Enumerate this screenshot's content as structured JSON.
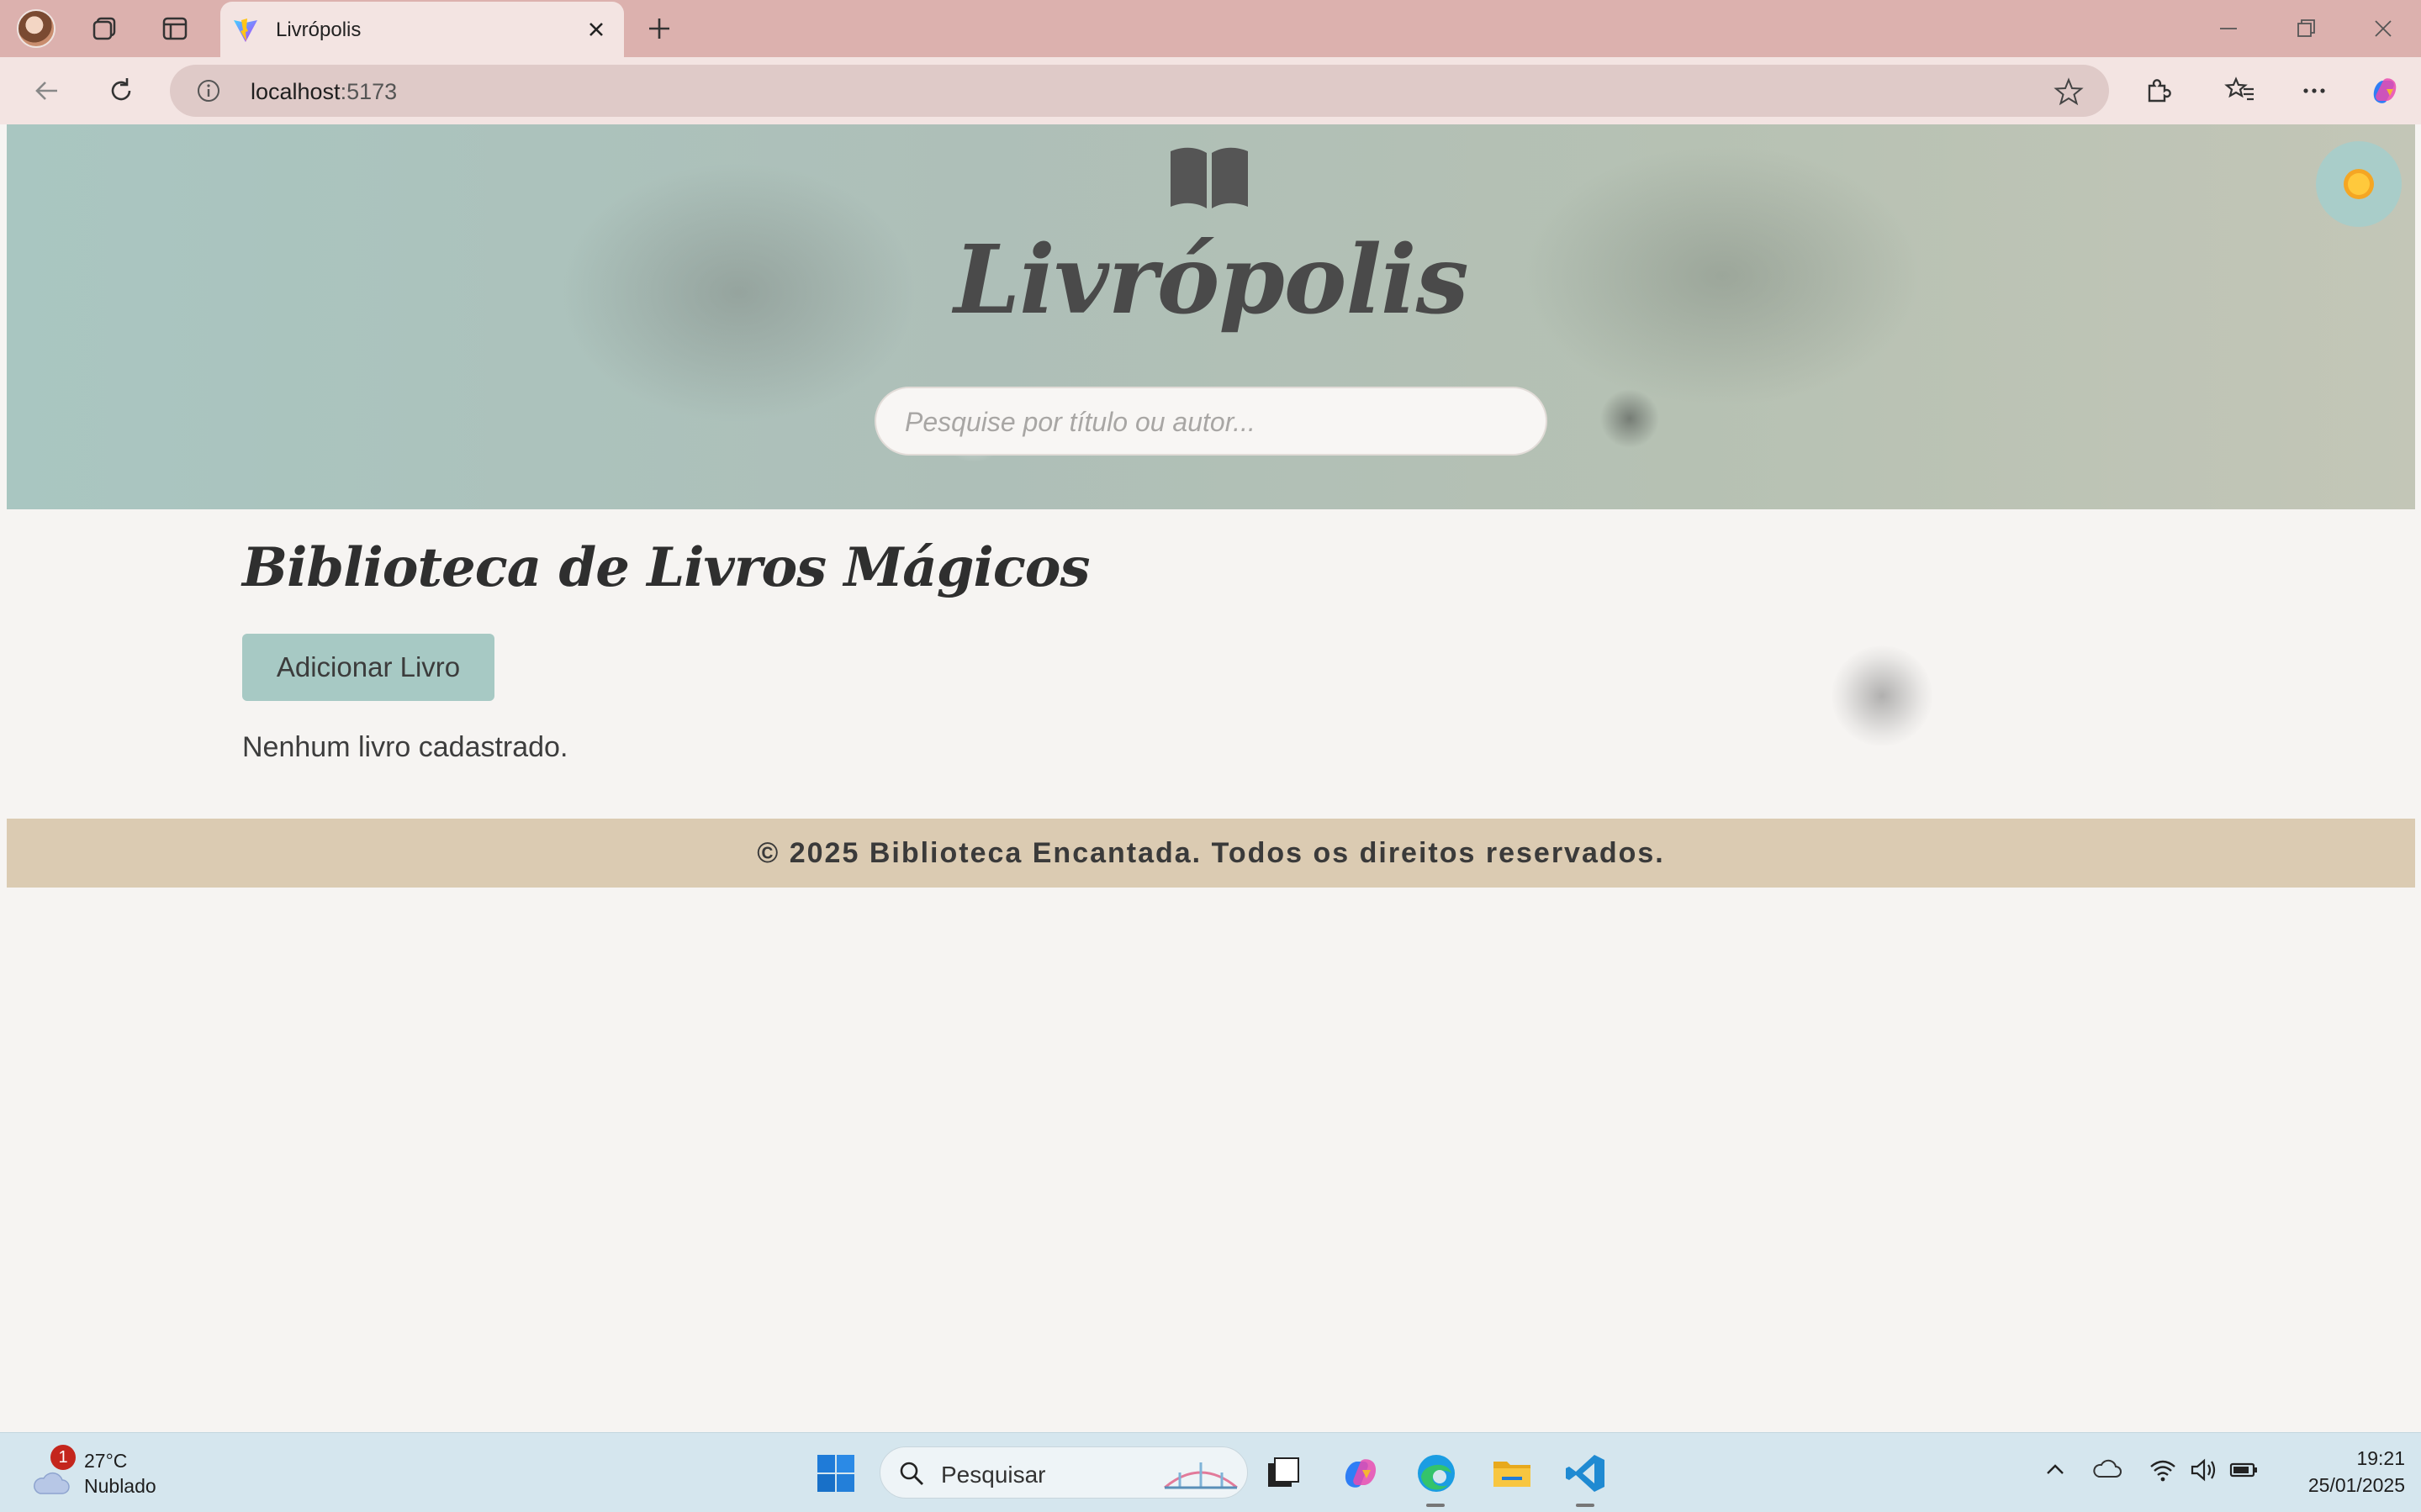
{
  "browser": {
    "tab_title": "Livrópolis",
    "url_host": "localhost",
    "url_port": ":5173"
  },
  "app": {
    "title": "Livrópolis",
    "search_placeholder": "Pesquise por título ou autor...",
    "section_title": "Biblioteca de Livros Mágicos",
    "add_button": "Adicionar Livro",
    "empty_message": "Nenhum livro cadastrado.",
    "footer": "© 2025 Biblioteca Encantada. Todos os direitos reservados."
  },
  "taskbar": {
    "weather_badge": "1",
    "temperature": "27°C",
    "weather_desc": "Nublado",
    "search_label": "Pesquisar",
    "time": "19:21",
    "date": "25/01/2025"
  },
  "colors": {
    "tabbar": "#dcb1ae",
    "toolbar": "#f3e4e2",
    "hero_teal": "#a9c6c1",
    "button": "#a7c9c4",
    "footer": "#dbcbb2",
    "sun": "#f5a623"
  }
}
